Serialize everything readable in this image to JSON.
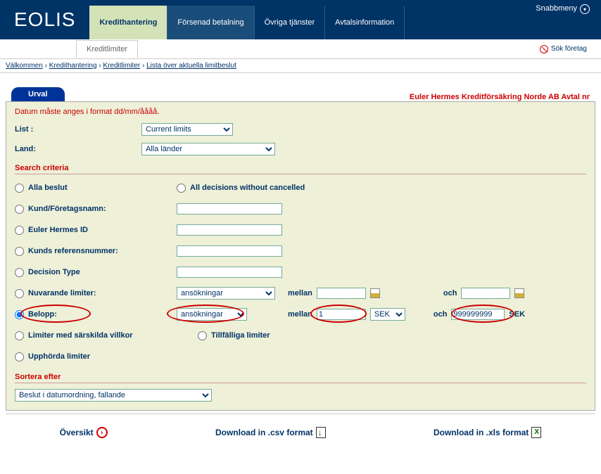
{
  "header": {
    "logo": "EOLIS",
    "tabs": [
      {
        "label": "Kredithantering",
        "active": true
      },
      {
        "label": "Försenad betalning",
        "active": false
      },
      {
        "label": "Övriga tjänster",
        "active": false
      },
      {
        "label": "Avtalsinformation",
        "active": false
      }
    ],
    "snabbmeny": "Snabbmeny",
    "subtab": "Kreditlimiter",
    "search_company": "Sök företag"
  },
  "breadcrumb": {
    "items": [
      "Välkommen",
      "Kredithantering",
      "Kreditlimiter",
      "Lista över aktuella limitbeslut"
    ],
    "sep": " › "
  },
  "urval_tab": "Urval",
  "company_info": "Euler Hermes Kreditförsäkring Norde AB Avtal nr",
  "date_warning": "Datum måste anges i format dd/mm/åååå.",
  "form": {
    "list_label": "List :",
    "list_value": "Current limits",
    "land_label": "Land:",
    "land_value": "Alla länder"
  },
  "criteria_title": "Search criteria",
  "criteria": {
    "alla_beslut": "Alla beslut",
    "all_without_cancelled": "All decisions without cancelled",
    "kund_foretag": "Kund/Företagsnamn:",
    "euler_id": "Euler Hermes ID",
    "kunds_ref": "Kunds referensnummer:",
    "decision_type": "Decision Type",
    "nuvarande": "Nuvarande limiter:",
    "nuvarande_sel": "ansökningar",
    "mellan": "mellan",
    "och": "och",
    "belopp": "Belopp:",
    "belopp_sel": "ansökningar",
    "belopp_from": "1",
    "belopp_to": "999999999",
    "currency": "SEK",
    "sek_suffix": "SEK",
    "limiter_villkor": "Limiter med särskilda villkor",
    "tillfalliga": "Tillfälliga limiter",
    "upphorda": "Upphörda limiter"
  },
  "sort_title": "Sortera efter",
  "sort_value": "Beslut i datumordning, fallande",
  "actions": {
    "oversikt": "Översikt",
    "csv": "Download  in  .csv  format",
    "xls": "Download  in  .xls  format"
  }
}
